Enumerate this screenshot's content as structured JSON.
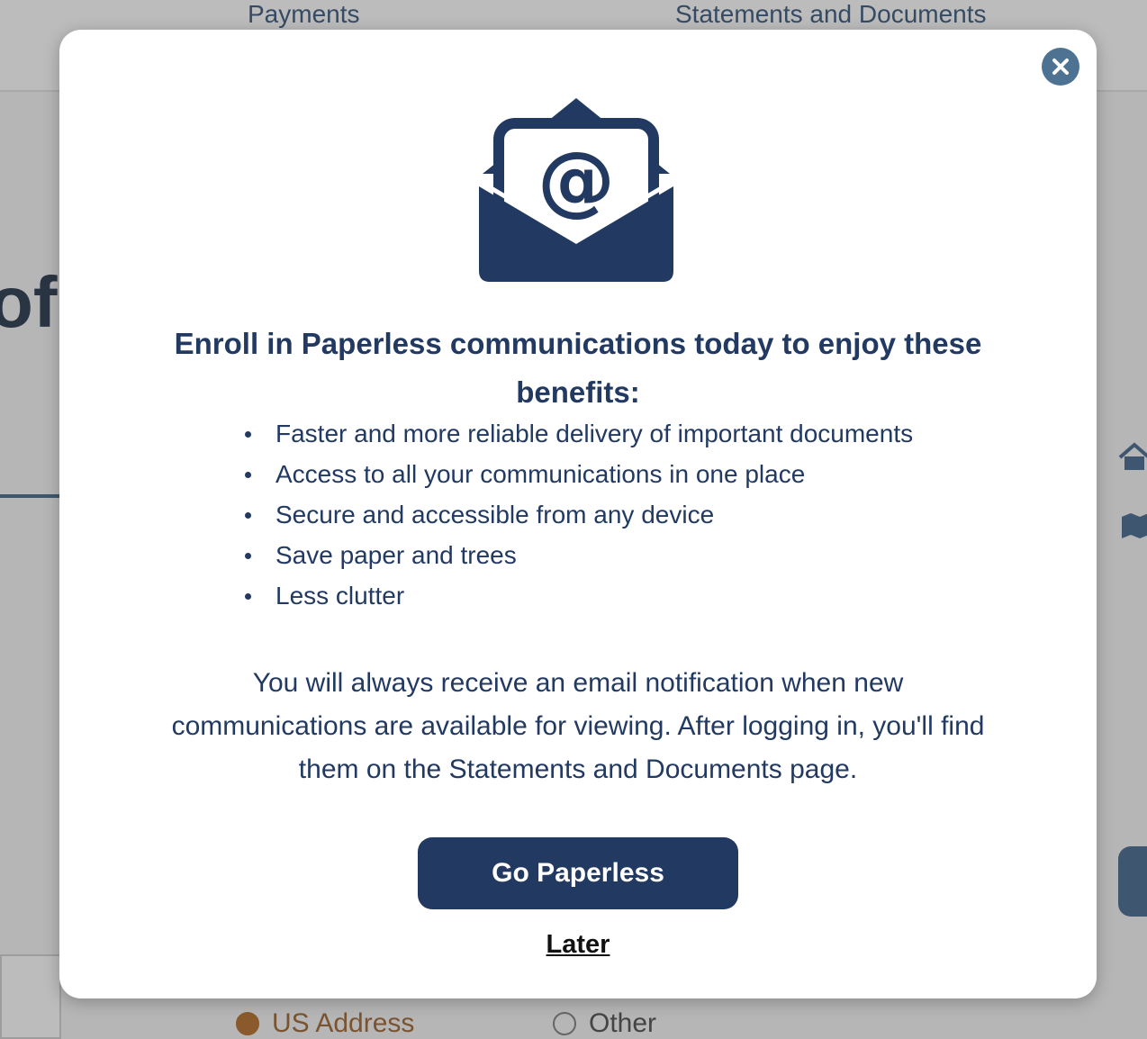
{
  "background": {
    "nav": [
      "Payments",
      "Statements and Documents"
    ],
    "partial_heading": "of",
    "radio_options": [
      "US Address",
      "Other"
    ]
  },
  "modal": {
    "close_icon": "close-icon",
    "illustration_icon": "envelope-at-icon",
    "title": "Enroll in Paperless communications today to enjoy these benefits:",
    "benefits": [
      "Faster and more reliable delivery of important documents",
      "Access to all your communications in one place",
      "Secure and accessible from any device",
      "Save paper and trees",
      "Less clutter"
    ],
    "notice": "You will always receive an email notification when new communications are available for viewing. After logging in, you'll find them on the Statements and Documents page.",
    "primary_button": "Go Paperless",
    "secondary_link": "Later"
  },
  "colors": {
    "primary": "#223a62",
    "close_button": "#4e7392",
    "overlay": "#b6b6b6"
  }
}
